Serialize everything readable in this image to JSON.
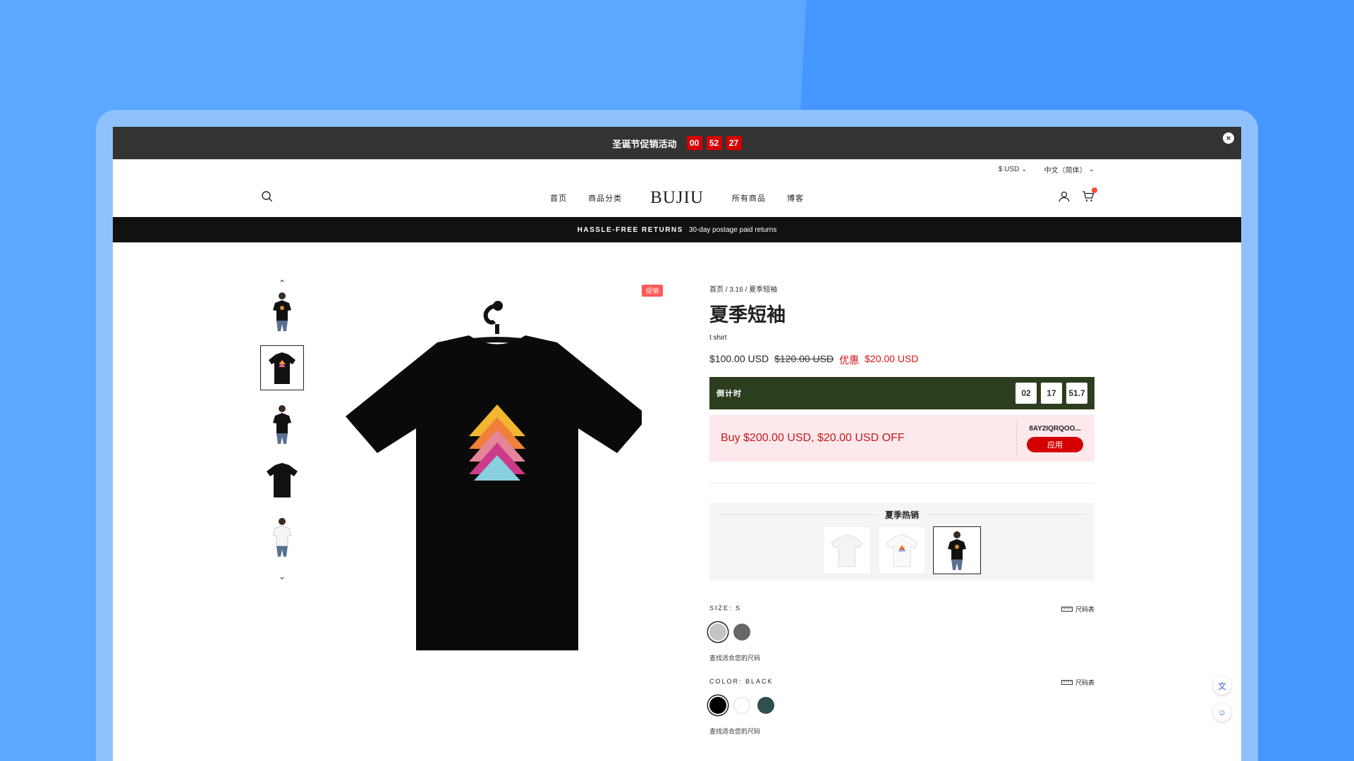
{
  "promo": {
    "text": "圣诞节促销活动",
    "timer": [
      "00",
      "52",
      "27"
    ]
  },
  "util": {
    "currency": "$ USD",
    "language": "中文（简体）"
  },
  "nav": {
    "home": "首页",
    "categories": "商品分类",
    "logo": "BUJIU",
    "all_products": "所有商品",
    "blog": "博客"
  },
  "announcement": {
    "bold": "HASSLE-FREE RETURNS",
    "text": "30-day postage paid returns"
  },
  "product": {
    "sale_tag": "促销",
    "breadcrumb": "首页 / 3.16 / 夏季短袖",
    "title": "夏季短袖",
    "subtitle": "t shirt",
    "price": "$100.00 USD",
    "compare_price": "$120.00 USD",
    "save_label": "优惠",
    "save_amount": "$20.00 USD",
    "countdown_label": "倒计时",
    "countdown": [
      "02",
      "17",
      "51.7"
    ]
  },
  "coupon": {
    "text": "Buy $200.00 USD, $20.00 USD OFF",
    "code": "8AY2IQRQOO...",
    "apply": "应用"
  },
  "hot": {
    "title": "夏季热销"
  },
  "size": {
    "label": "SIZE: S",
    "guide": "尺码表",
    "hint": "查找适合您的尺码"
  },
  "color": {
    "label": "COLOR: BLACK",
    "guide": "尺码表",
    "hint": "查找适合您的尺码",
    "swatches": [
      "#000000",
      "#ffffff",
      "#2e4f4d"
    ]
  },
  "colors": {
    "sale": "#ff5a5a",
    "countdown_bg": "#2d3e1e",
    "accent_red": "#d40000"
  }
}
